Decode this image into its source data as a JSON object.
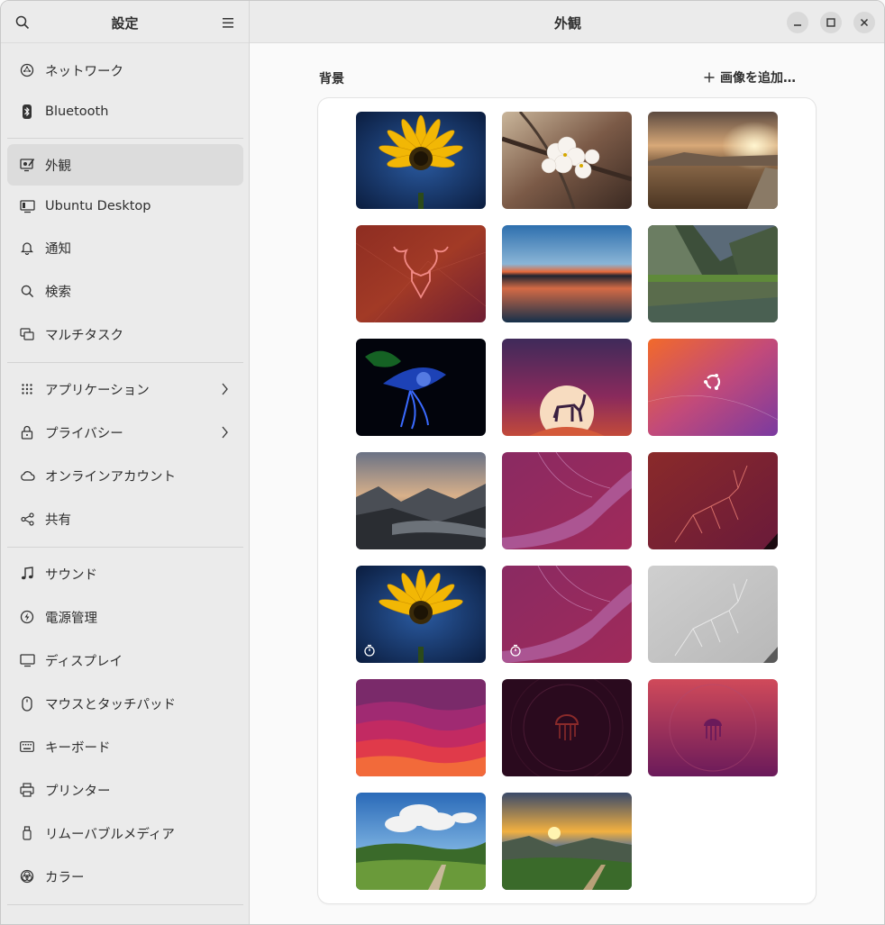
{
  "sidebar": {
    "title": "設定",
    "items": [
      {
        "label": "ネットワーク",
        "icon": "network-icon"
      },
      {
        "label": "Bluetooth",
        "icon": "bluetooth-icon"
      },
      {
        "label": "外観",
        "icon": "appearance-icon",
        "active": true
      },
      {
        "label": "Ubuntu Desktop",
        "icon": "desktop-icon"
      },
      {
        "label": "通知",
        "icon": "bell-icon"
      },
      {
        "label": "検索",
        "icon": "search-icon"
      },
      {
        "label": "マルチタスク",
        "icon": "multitask-icon"
      },
      {
        "label": "アプリケーション",
        "icon": "apps-grid-icon",
        "chevron": true
      },
      {
        "label": "プライバシー",
        "icon": "lock-icon",
        "chevron": true
      },
      {
        "label": "オンラインアカウント",
        "icon": "cloud-icon"
      },
      {
        "label": "共有",
        "icon": "share-icon"
      },
      {
        "label": "サウンド",
        "icon": "music-note-icon"
      },
      {
        "label": "電源管理",
        "icon": "power-icon"
      },
      {
        "label": "ディスプレイ",
        "icon": "monitor-icon"
      },
      {
        "label": "マウスとタッチパッド",
        "icon": "mouse-icon"
      },
      {
        "label": "キーボード",
        "icon": "keyboard-icon"
      },
      {
        "label": "プリンター",
        "icon": "printer-icon"
      },
      {
        "label": "リムーバブルメディア",
        "icon": "usb-icon"
      },
      {
        "label": "カラー",
        "icon": "color-icon"
      }
    ]
  },
  "main": {
    "title": "外観",
    "section_label": "背景",
    "add_image_label": "画像を追加…",
    "wallpapers": [
      {
        "name": "sunflower",
        "timed": false
      },
      {
        "name": "cherry-blossom",
        "timed": false
      },
      {
        "name": "sunset-field",
        "timed": false
      },
      {
        "name": "kudu-red",
        "timed": false
      },
      {
        "name": "lake-sunset",
        "timed": false
      },
      {
        "name": "mountain-lake",
        "timed": false
      },
      {
        "name": "blue-light-bird",
        "timed": false
      },
      {
        "name": "deer-moon",
        "timed": false
      },
      {
        "name": "ubuntu-logo-gradient",
        "timed": false
      },
      {
        "name": "misty-mountains",
        "timed": false
      },
      {
        "name": "purple-ribbon",
        "timed": false
      },
      {
        "name": "kudu-outline-red",
        "timed": false
      },
      {
        "name": "sunflower-timed",
        "timed": true
      },
      {
        "name": "purple-ribbon-timed",
        "timed": true
      },
      {
        "name": "kudu-outline-gray",
        "timed": false
      },
      {
        "name": "waves-gradient",
        "timed": false
      },
      {
        "name": "jellyfish-dark",
        "timed": false
      },
      {
        "name": "jellyfish-magenta",
        "timed": false
      },
      {
        "name": "green-hills-sky",
        "timed": false
      },
      {
        "name": "valley-sunrise",
        "timed": false
      }
    ]
  },
  "colors": {
    "sidebar_bg": "#ebebeb",
    "active_bg": "#dcdcdc",
    "window_bg": "#fafafa"
  }
}
